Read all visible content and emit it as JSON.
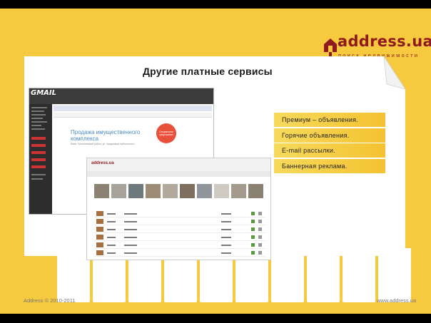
{
  "logo": {
    "brand": "address.ua",
    "tagline": "поиск недвижимости"
  },
  "title": "Другие платные сервисы",
  "screenshot_email": {
    "app_logo": "GMAIL",
    "headline": "Продажа имущественного комплекса",
    "subline": "Киев, Голосеевский район, ул. Академика Заболотного",
    "badge": "Специальное предложение"
  },
  "screenshot_site": {
    "site_logo": "address.ua"
  },
  "services": [
    "Премиум – объявления.",
    "Горячие объявления.",
    "E-mail рассылки.",
    "Баннерная реклама."
  ],
  "footer": {
    "copyright": "Address © 2010-2011",
    "url": "www.address.ua"
  },
  "colors": {
    "background": "#F6C93E",
    "brand": "#8E1A1E",
    "service_bar": "#F4C231"
  },
  "icons": [
    "house-logo-icon"
  ]
}
